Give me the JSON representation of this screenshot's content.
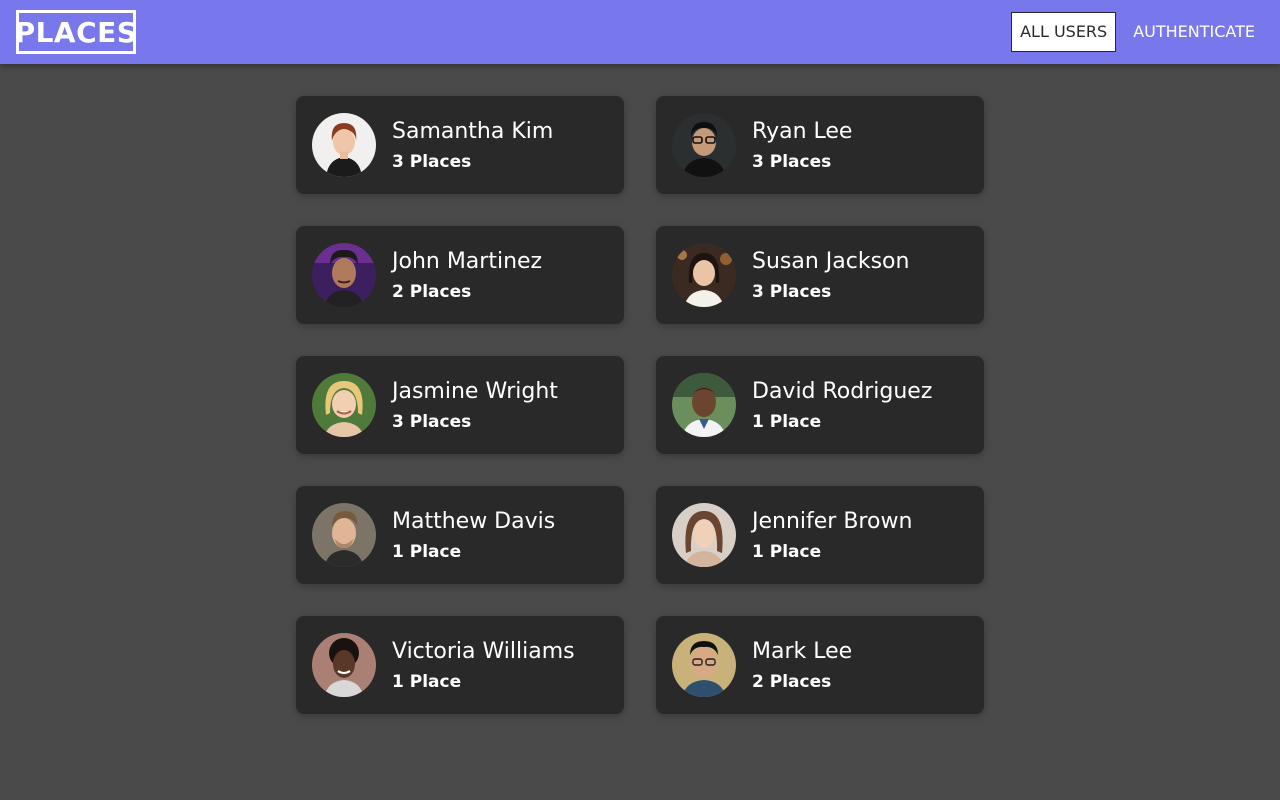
{
  "header": {
    "logo": "PLACES",
    "nav": [
      {
        "label": "ALL USERS",
        "active": true
      },
      {
        "label": "AUTHENTICATE",
        "active": false
      }
    ]
  },
  "users": [
    {
      "name": "Samantha Kim",
      "places": "3 Places"
    },
    {
      "name": "Ryan Lee",
      "places": "3 Places"
    },
    {
      "name": "John Martinez",
      "places": "2 Places"
    },
    {
      "name": "Susan Jackson",
      "places": "3 Places"
    },
    {
      "name": "Jasmine Wright",
      "places": "3 Places"
    },
    {
      "name": "David Rodriguez",
      "places": "1 Place"
    },
    {
      "name": "Matthew Davis",
      "places": "1 Place"
    },
    {
      "name": "Jennifer Brown",
      "places": "1 Place"
    },
    {
      "name": "Victoria Williams",
      "places": "1 Place"
    },
    {
      "name": "Mark Lee",
      "places": "2 Places"
    }
  ],
  "colors": {
    "header": "#7878ec",
    "background": "#4a4a4a",
    "card": "#292929"
  }
}
